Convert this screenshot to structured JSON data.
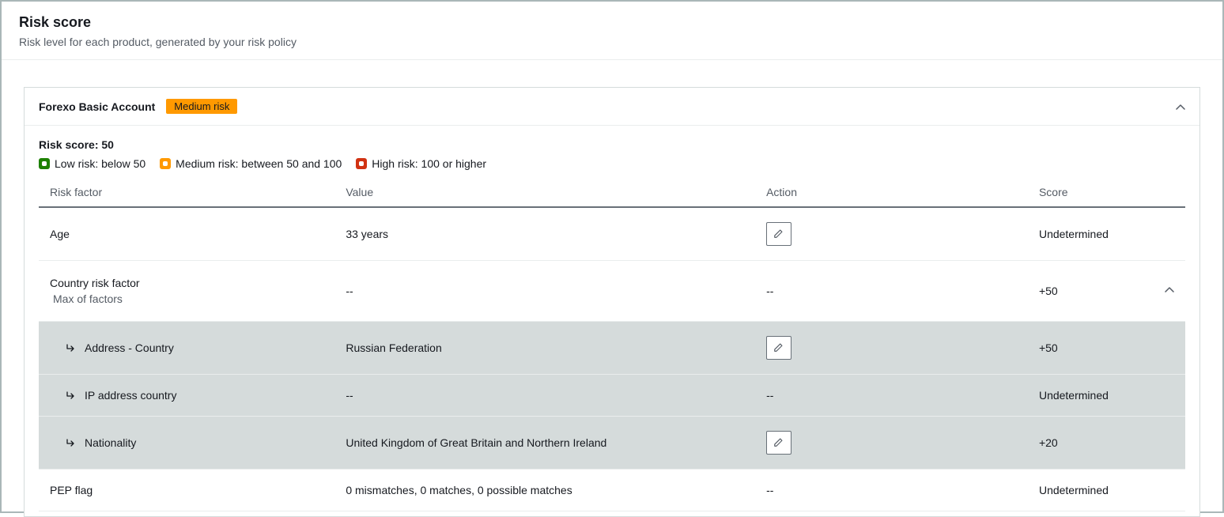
{
  "header": {
    "title": "Risk score",
    "subtitle": "Risk level for each product, generated by your risk policy"
  },
  "product": {
    "name": "Forexo Basic Account",
    "risk_badge": "Medium risk",
    "risk_score_label": "Risk score: 50",
    "legend": {
      "low": "Low risk: below 50",
      "medium": "Medium risk: between 50 and 100",
      "high": "High risk: 100 or higher"
    }
  },
  "columns": {
    "factor": "Risk factor",
    "value": "Value",
    "action": "Action",
    "score": "Score"
  },
  "rows": {
    "age": {
      "factor": "Age",
      "value": "33 years",
      "score": "Undetermined"
    },
    "country": {
      "factor": "Country risk factor",
      "sub": "Max of factors",
      "value": "--",
      "action": "--",
      "score": "+50"
    },
    "addr": {
      "factor": "Address - Country",
      "value": "Russian Federation",
      "score": "+50"
    },
    "ip": {
      "factor": "IP address country",
      "value": "--",
      "action": "--",
      "score": "Undetermined"
    },
    "nat": {
      "factor": "Nationality",
      "value": "United Kingdom of Great Britain and Northern Ireland",
      "score": "+20"
    },
    "pep": {
      "factor": "PEP flag",
      "value": "0 mismatches, 0 matches, 0 possible matches",
      "action": "--",
      "score": "Undetermined"
    }
  }
}
